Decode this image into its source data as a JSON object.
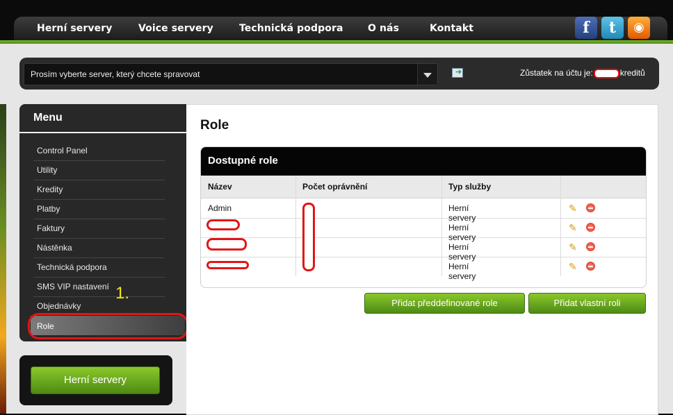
{
  "nav": {
    "items": [
      "Herní servery",
      "Voice servery",
      "Technická podpora",
      "O nás",
      "Kontakt"
    ]
  },
  "social": {
    "facebook": "f",
    "twitter": "t",
    "rss": "◉"
  },
  "serverbar": {
    "select_value": "Prosím vyberte server, který chcete spravovat",
    "balance_prefix": "Zůstatek na účtu je:",
    "balance_suffix": "kreditů"
  },
  "menu": {
    "title": "Menu",
    "items": [
      "Control Panel",
      "Utility",
      "Kredity",
      "Platby",
      "Faktury",
      "Nástěnka",
      "Technická podpora",
      "SMS VIP nastavení",
      "Objednávky",
      "Role"
    ],
    "annotation": "1."
  },
  "gamebox": {
    "button": "Herní servery"
  },
  "content": {
    "title": "Role",
    "table": {
      "title": "Dostupné role",
      "columns": [
        "Název",
        "Počet oprávnění",
        "Typ služby",
        ""
      ],
      "rows": [
        {
          "name": "Admin",
          "service": "Herní servery"
        },
        {
          "name": "",
          "service": "Herní servery"
        },
        {
          "name": "",
          "service": "Herní servery"
        },
        {
          "name": "",
          "service": "Herní servery"
        }
      ]
    },
    "buttons": {
      "predefined": "Přidat předdefinované role",
      "custom": "Přidat vlastní roli"
    }
  },
  "colors": {
    "accent_green": "#6aa61e",
    "highlight_red": "#e31515",
    "annotation_yellow": "#f5e61b"
  }
}
